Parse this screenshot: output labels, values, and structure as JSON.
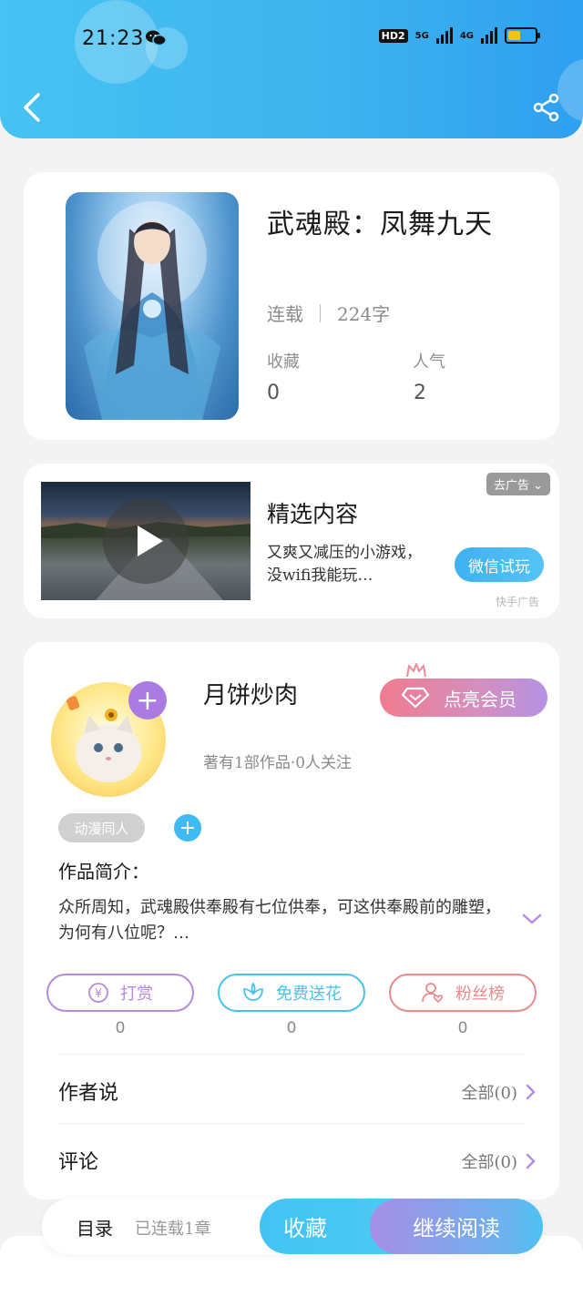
{
  "status_bar": {
    "time": "21:23",
    "hd_badge": "HD2",
    "net1": "5G",
    "net2": "4G"
  },
  "book": {
    "title": "武魂殿：凤舞九天",
    "status": "连载",
    "word_count": "224字",
    "favorites_label": "收藏",
    "favorites_value": "0",
    "popularity_label": "人气",
    "popularity_value": "2"
  },
  "ad": {
    "title": "精选内容",
    "description": "又爽又减压的小游戏，没wifi我能玩…",
    "remove_label": "去广告",
    "cta_label": "微信试玩",
    "source": "快手广告"
  },
  "author": {
    "name": "月饼炒肉",
    "vip_label": "点亮会员",
    "meta": "著有1部作品·0人关注",
    "tag": "动漫同人",
    "intro_label": "作品简介：",
    "intro_text": "众所周知，武魂殿供奉殿有七位供奉，可这供奉殿前的雕塑，为何有八位呢？…"
  },
  "actions": [
    {
      "label": "打赏",
      "count": "0",
      "color": "#b38be0"
    },
    {
      "label": "免费送花",
      "count": "0",
      "color": "#46c2ef"
    },
    {
      "label": "粉丝榜",
      "count": "0",
      "color": "#e88a8e"
    }
  ],
  "rows": {
    "author_says_label": "作者说",
    "author_says_link": "全部(0)",
    "comments_label": "评论",
    "comments_link": "全部(0)"
  },
  "bottom_bar": {
    "toc_label": "目录",
    "chapters_label": "已连载1章",
    "collect_label": "收藏",
    "read_label": "继续阅读"
  },
  "colors": {
    "header_blue": "#3fb4ee",
    "accent_purple": "#a97be3",
    "accent_cyan": "#3fbaf2",
    "vip_pink": "#f07b8e"
  },
  "icons": [
    "back-icon",
    "share-icon",
    "wechat-icon",
    "play-icon",
    "diamond-icon",
    "crown-icon",
    "plus-icon",
    "chevron-down-icon",
    "yen-icon",
    "flower-icon",
    "fan-icon",
    "chevron-right-icon"
  ]
}
